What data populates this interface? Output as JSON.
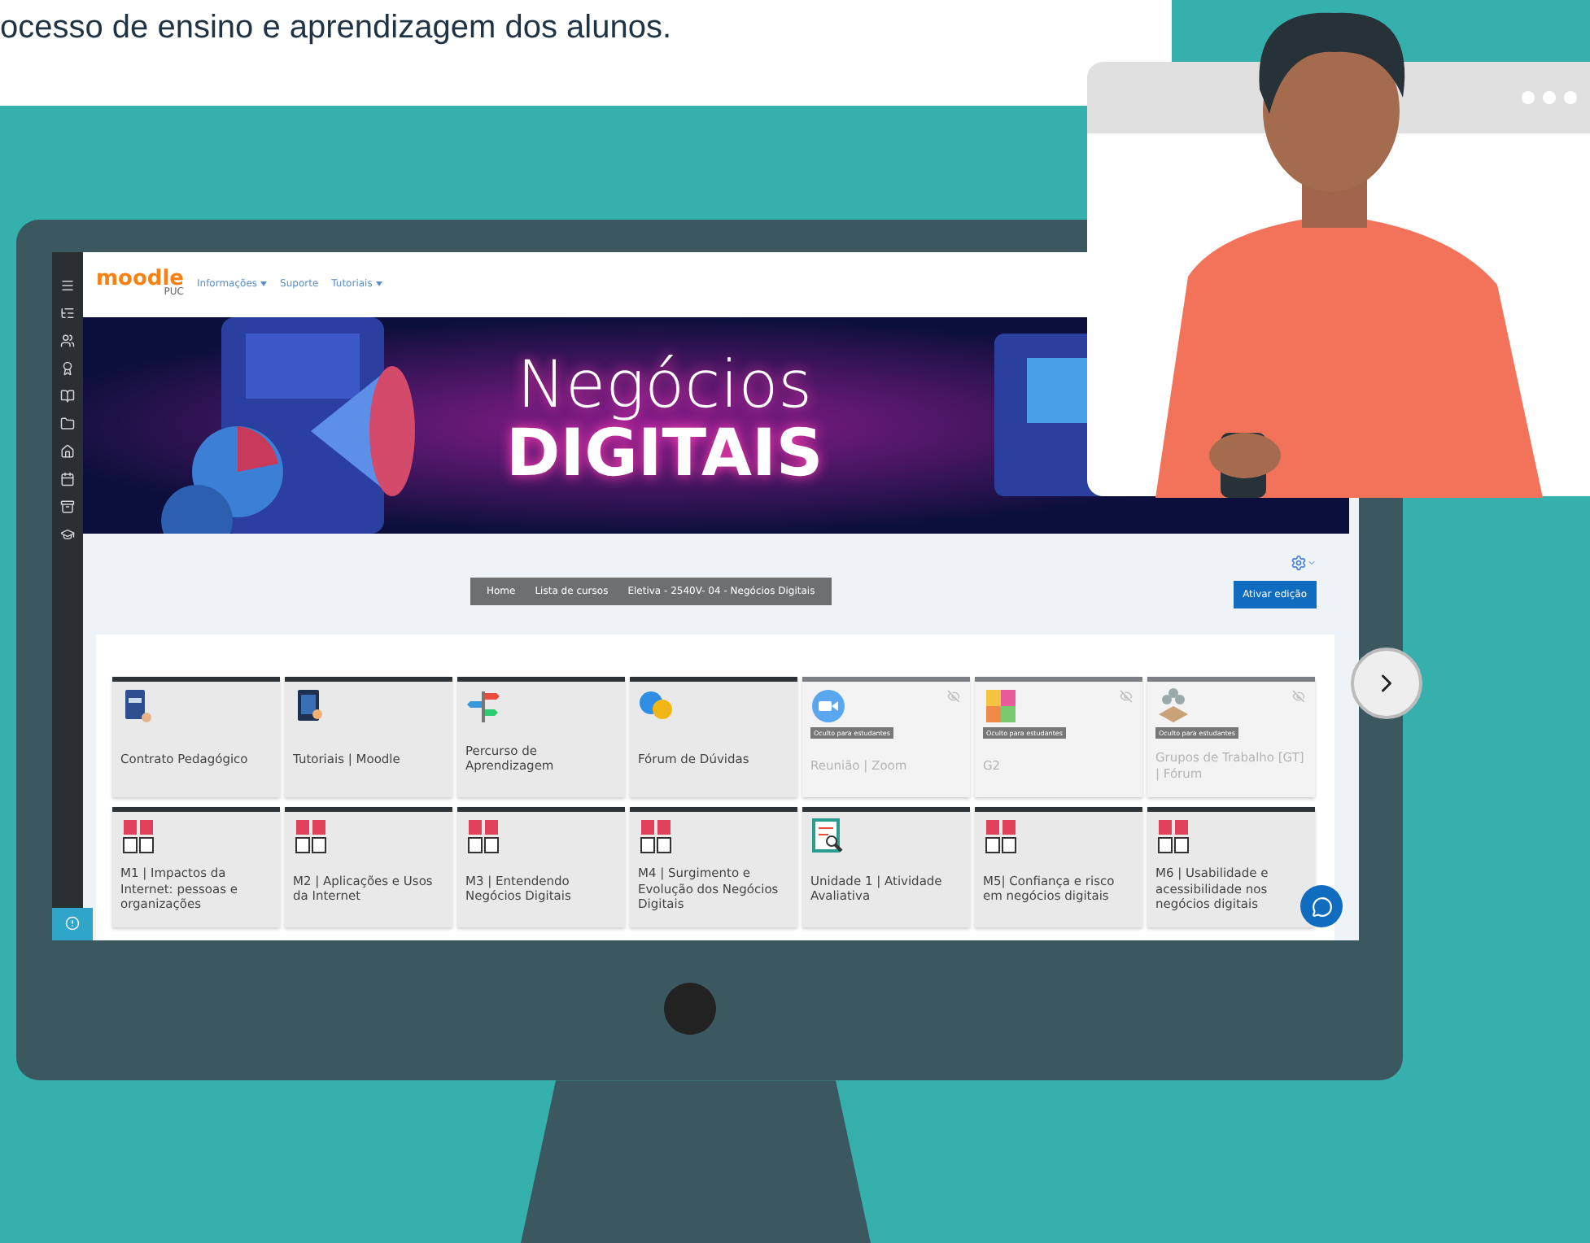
{
  "intro_text": "ocesso de ensino e aprendizagem dos alunos.",
  "logo": {
    "name": "moodle",
    "sub": "PUC"
  },
  "nav_menu": [
    {
      "label": "Informações",
      "dropdown": true
    },
    {
      "label": "Suporte",
      "dropdown": false
    },
    {
      "label": "Tutoriais",
      "dropdown": true
    }
  ],
  "banner": {
    "title": "Negócios",
    "subtitle": "DIGITAIS"
  },
  "breadcrumbs": [
    "Home",
    "Lista de cursos",
    "Eletiva - 2540V- 04 - Negócios Digitais"
  ],
  "edit_button": "Ativar edição",
  "tiles": [
    {
      "label": "Contrato Pedagógico",
      "kind": "document",
      "hidden": false
    },
    {
      "label": "Tutoriais | Moodle",
      "kind": "tablet",
      "hidden": false
    },
    {
      "label": "Percurso de Aprendizagem",
      "kind": "signpost",
      "hidden": false
    },
    {
      "label": "Fórum de Dúvidas",
      "kind": "chat",
      "hidden": false
    },
    {
      "label": "Reunião | Zoom",
      "kind": "video",
      "hidden": true,
      "badge": "Oculto para estudantes"
    },
    {
      "label": "G2",
      "kind": "puzzle",
      "hidden": true,
      "badge": "Oculto para estudantes"
    },
    {
      "label": "Grupos de Trabalho [GT] | Fórum",
      "kind": "network",
      "hidden": true,
      "badge": "Oculto para estudantes"
    },
    {
      "label": "M1 | Impactos da Internet: pessoas e organizações",
      "kind": "book",
      "hidden": false
    },
    {
      "label": "M2 | Aplicações e Usos da Internet",
      "kind": "book",
      "hidden": false
    },
    {
      "label": "M3 | Entendendo Negócios Digitais",
      "kind": "book",
      "hidden": false
    },
    {
      "label": "M4 | Surgimento e Evolução dos Negócios Digitais",
      "kind": "book",
      "hidden": false
    },
    {
      "label": "Unidade 1 | Atividade Avaliativa",
      "kind": "quiz",
      "hidden": false
    },
    {
      "label": "M5| Confiança e risco em negócios digitais",
      "kind": "book",
      "hidden": false
    },
    {
      "label": "M6 | Usabilidade e acessibilidade nos negócios digitais",
      "kind": "book",
      "hidden": false
    }
  ]
}
